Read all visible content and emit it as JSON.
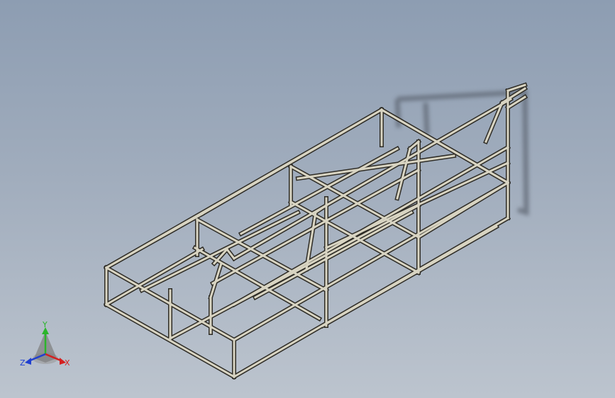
{
  "viewport": {
    "background_top": "#8d9db2",
    "background_bottom": "#bcc4ce"
  },
  "model": {
    "name": "steel-tube-frame",
    "tube_color": "#d8d4c2",
    "edge_color": "#2e2c26",
    "shadow_color": "#5c6470"
  },
  "triad": {
    "y_label": "Y",
    "x_label": "X",
    "z_label": "Z",
    "y_color": "#2bb52b",
    "x_color": "#d42020",
    "z_color": "#2040d0"
  }
}
